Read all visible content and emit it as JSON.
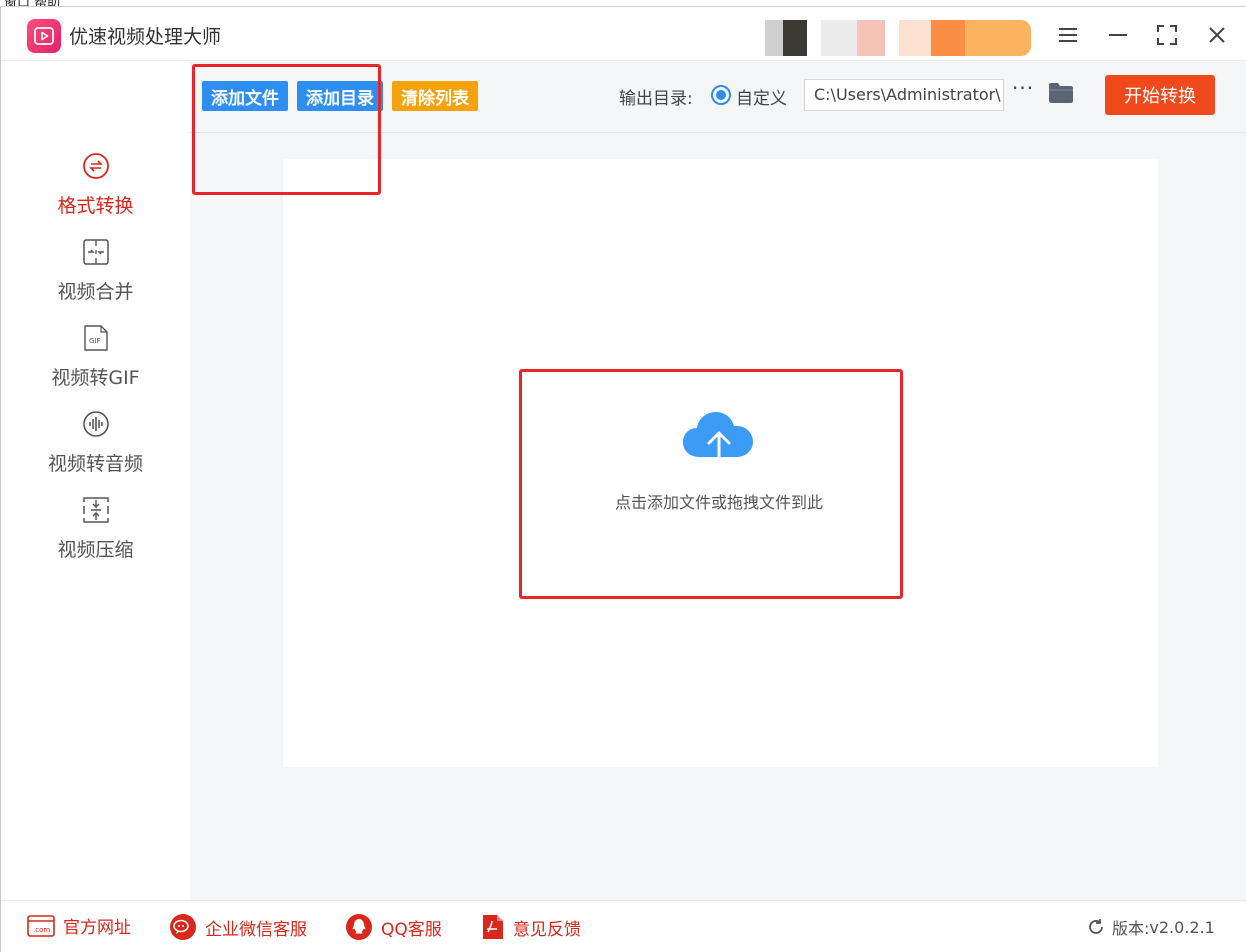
{
  "background_window": {
    "menu_text": "窗口 帮助"
  },
  "app": {
    "title": "优速视频处理大师"
  },
  "window_controls": {
    "menu": "menu-icon",
    "minimize": "minimize-icon",
    "maximize": "maximize-icon",
    "close": "close-icon"
  },
  "sidebar": {
    "items": [
      {
        "label": "格式转换",
        "icon": "format-convert-icon",
        "active": true
      },
      {
        "label": "视频合并",
        "icon": "merge-icon",
        "active": false
      },
      {
        "label": "视频转GIF",
        "icon": "gif-icon",
        "active": false
      },
      {
        "label": "视频转音频",
        "icon": "audio-icon",
        "active": false
      },
      {
        "label": "视频压缩",
        "icon": "compress-icon",
        "active": false
      }
    ]
  },
  "toolbar": {
    "add_file": "添加文件",
    "add_folder": "添加目录",
    "clear_list": "清除列表",
    "output_label": "输出目录:",
    "custom_option": "自定义",
    "output_path": "C:\\Users\\Administrator\\",
    "more": "···",
    "start": "开始转换"
  },
  "dropzone": {
    "hint": "点击添加文件或拖拽文件到此"
  },
  "footer": {
    "website": "官方网址",
    "wechat": "企业微信客服",
    "qq": "QQ客服",
    "feedback": "意见反馈",
    "version_label": "版本:",
    "version": "v2.0.2.1"
  },
  "colors": {
    "accent_blue": "#2e8ef2",
    "accent_orange": "#f7a20d",
    "start_red": "#f04a1c",
    "active_red": "#d9281b",
    "annotation": "#e8262a"
  }
}
